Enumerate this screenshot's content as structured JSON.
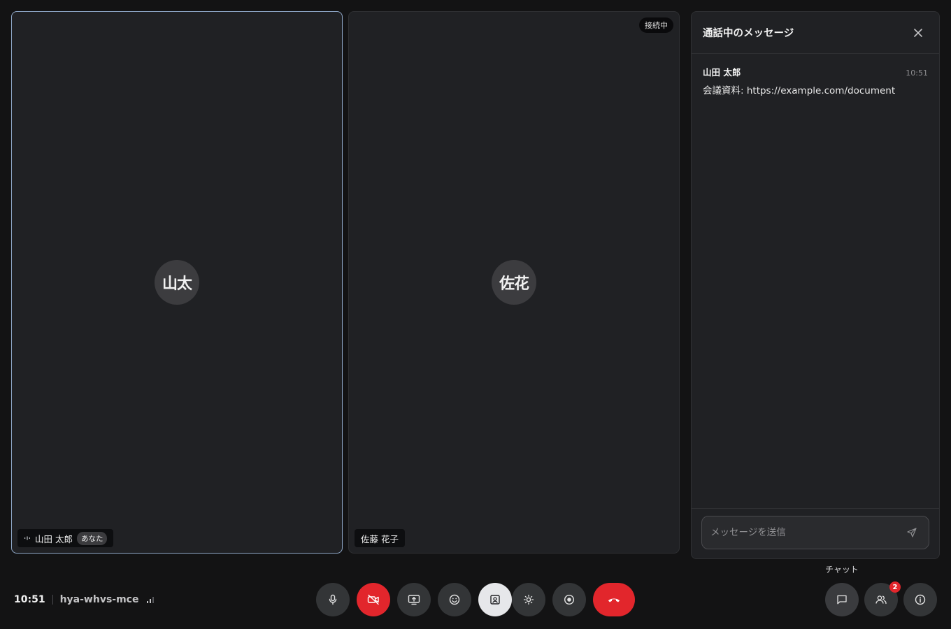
{
  "participants": {
    "self": {
      "initials": "山太",
      "name": "山田 太郎",
      "you_badge": "あなた"
    },
    "other": {
      "initials": "佐花",
      "name": "佐藤 花子",
      "status": "接続中"
    }
  },
  "chat": {
    "title": "通話中のメッセージ",
    "messages": [
      {
        "author": "山田 太郎",
        "time": "10:51",
        "text": "会議資料: https://example.com/document"
      }
    ],
    "input_placeholder": "メッセージを送信"
  },
  "meeting": {
    "time": "10:51",
    "code": "hya-whvs-mce"
  },
  "controls": {
    "chat_tooltip": "チャット",
    "people_badge_count": "2"
  },
  "colors": {
    "background": "#131314",
    "tile": "#202124",
    "active_border": "#8fa8c8",
    "danger": "#e2262c",
    "button": "#333537",
    "button_active": "#e6e7ea"
  },
  "icons": {
    "speaking": "audio-level-icon",
    "close": "close-icon",
    "send": "send-icon",
    "mic": "microphone-icon",
    "camera_off": "video-off-icon",
    "present": "present-screen-icon",
    "emoji": "emoji-icon",
    "captions": "portrait-frame-icon",
    "effects": "effects-icon",
    "record": "record-icon",
    "hangup": "hang-up-icon",
    "chat": "chat-icon",
    "people": "people-icon",
    "info": "info-icon",
    "signal": "signal-strength-icon"
  }
}
